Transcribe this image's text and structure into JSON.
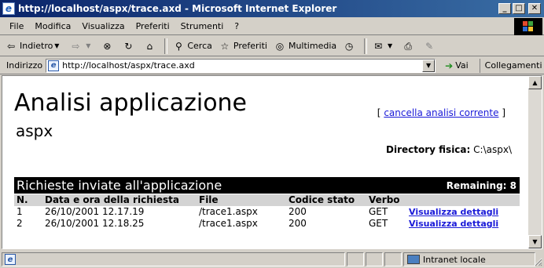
{
  "window": {
    "title": "http://localhost/aspx/trace.axd - Microsoft Internet Explorer",
    "buttons": {
      "minimize": "_",
      "maximize": "□",
      "close": "✕"
    }
  },
  "menu": [
    "File",
    "Modifica",
    "Visualizza",
    "Preferiti",
    "Strumenti",
    "?"
  ],
  "toolbar": {
    "back": "Indietro",
    "search": "Cerca",
    "favorites": "Preferiti",
    "media": "Multimedia"
  },
  "address": {
    "label": "Indirizzo",
    "value": "http://localhost/aspx/trace.axd",
    "go": "Vai",
    "links": "Collegamenti"
  },
  "page": {
    "title": "Analisi applicazione",
    "subtitle": "aspx",
    "clear_link": "cancella analisi corrente",
    "bracket_open": "[",
    "bracket_close": "]",
    "physical_dir_label": "Directory fisica:",
    "physical_dir_value": "C:\\aspx\\"
  },
  "requests": {
    "section_title": "Richieste inviate all'applicazione",
    "remaining": "Remaining: 8",
    "columns": [
      "N.",
      "Data e ora della richiesta",
      "File",
      "Codice stato",
      "Verbo",
      ""
    ],
    "rows": [
      {
        "n": "1",
        "datetime": "26/10/2001 12.17.19",
        "file": "/trace1.aspx",
        "status": "200",
        "verb": "GET",
        "link": "Visualizza dettagli"
      },
      {
        "n": "2",
        "datetime": "26/10/2001 12.18.25",
        "file": "/trace1.aspx",
        "status": "200",
        "verb": "GET",
        "link": "Visualizza dettagli"
      }
    ]
  },
  "status": {
    "zone": "Intranet locale"
  },
  "colors": {
    "titlebar_start": "#0a246a",
    "titlebar_end": "#3a6ea5",
    "link": "#1a1ad8",
    "section_bar": "#000000",
    "table_header": "#d3d3d3"
  }
}
